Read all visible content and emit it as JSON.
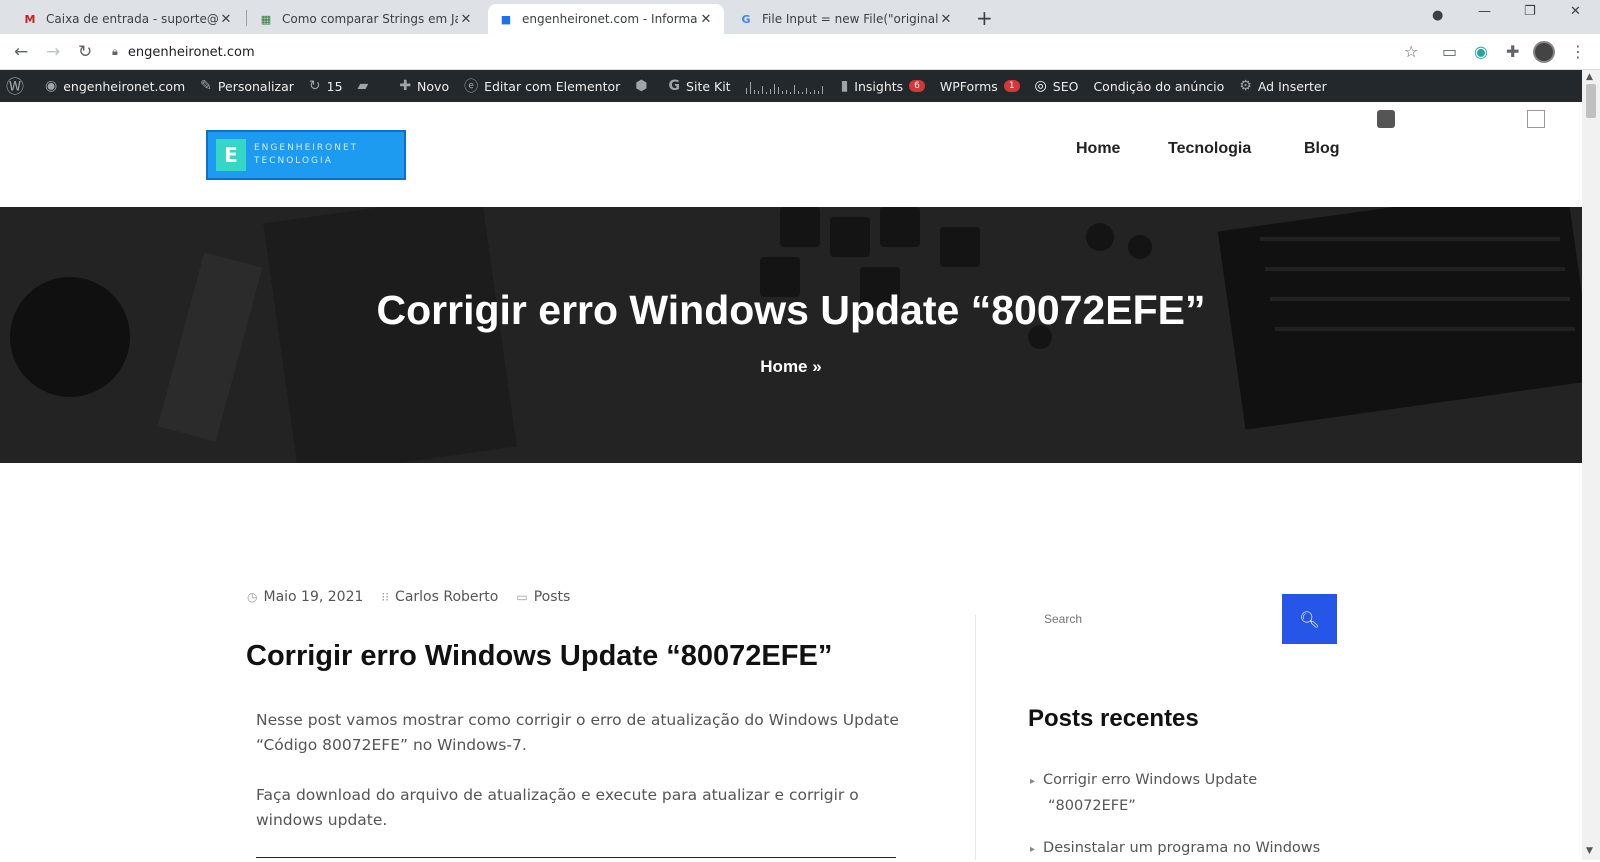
{
  "browser": {
    "tabs": [
      {
        "favicon": "M",
        "title": "Caixa de entrada - suporte@ult..."
      },
      {
        "favicon": "▦",
        "title": "Como comparar Strings em Ja..."
      },
      {
        "favicon": "■",
        "title": "engenheironet.com - Informaçõ..."
      },
      {
        "favicon": "G",
        "title": "File Input = new File(\"original.c..."
      }
    ],
    "new_tab": "+",
    "url": "engenheironet.com"
  },
  "adminbar": {
    "site": "engenheironet.com",
    "customize": "Personalizar",
    "updates": "15",
    "new": "Novo",
    "elementor": "Editar com Elementor",
    "sitekit": "Site Kit",
    "insights": "Insights",
    "insights_badge": "6",
    "wpforms": "WPForms",
    "wpforms_badge": "1",
    "seo": "SEO",
    "ad_condition": "Condição do anúncio",
    "ad_inserter": "Ad Inserter"
  },
  "header": {
    "logo_text_1": "ENGENHEIRONET",
    "logo_text_2": "TECNOLOGIA",
    "menu": [
      "Home",
      "Tecnologia",
      "Blog"
    ]
  },
  "hero": {
    "title": "Corrigir erro Windows Update “80072EFE”",
    "breadcrumb": "Home »"
  },
  "post": {
    "date": "Maio 19, 2021",
    "author": "Carlos Roberto",
    "category": "Posts",
    "title": "Corrigir erro Windows Update “80072EFE”",
    "paragraphs": [
      [
        "Nesse post vamos mostrar como corrigir o erro de atualização do Windows Update",
        "“Código 80072EFE” no Windows-7."
      ],
      [
        "Faça download do arquivo de atualização e execute para atualizar e corrigir o",
        "windows update."
      ]
    ]
  },
  "sidebar": {
    "search_placeholder": "Search",
    "recent_title": "Posts recentes",
    "recent_posts": [
      [
        "Corrigir erro Windows Update",
        "“80072EFE”"
      ],
      [
        "Desinstalar um programa no Windows"
      ]
    ]
  },
  "colors": {
    "accent": "#2556e8",
    "adminbar": "#23282d",
    "badge": "#d63638"
  }
}
